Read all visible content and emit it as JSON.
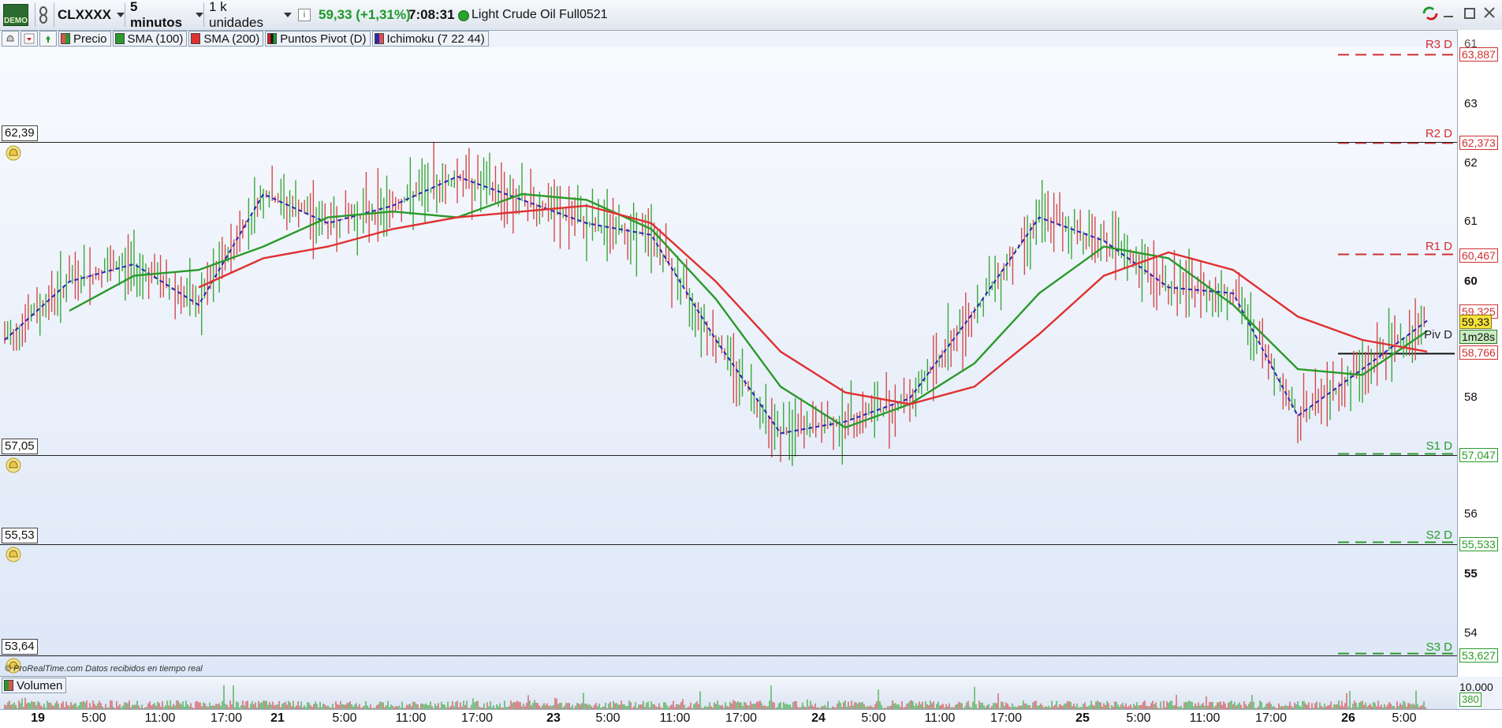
{
  "toolbar": {
    "demo_label": "DEMO",
    "ticker": "CLXXXX",
    "timeframe": "5 minutos",
    "units": "1 k unidades",
    "info_icon": "i",
    "price_change": "59,33 (+1,31%)",
    "time": "7:08:31",
    "instrument": "Light Crude Oil Full0521",
    "status_color": "#29a329"
  },
  "legend": {
    "items": [
      {
        "label": "Precio",
        "color": "#e05050"
      },
      {
        "label": "SMA (100)",
        "color": "#2a9a2a"
      },
      {
        "label": "SMA (200)",
        "color": "#e03030"
      },
      {
        "label": "Puntos Pivot (D)",
        "color": "#222222"
      },
      {
        "label": "Ichimoku (7 22 44)",
        "color": "#2a2aaa"
      }
    ]
  },
  "alert_lines": [
    {
      "label": "62,39"
    },
    {
      "label": "57,05"
    },
    {
      "label": "55,53"
    },
    {
      "label": "53,64"
    }
  ],
  "pivots": [
    {
      "label": "R3 D",
      "value": "63,887",
      "color": "#d03030"
    },
    {
      "label": "R2 D",
      "value": "62,373",
      "color": "#d03030"
    },
    {
      "label": "R1 D",
      "value": "60,467",
      "color": "#d03030"
    },
    {
      "label": "Piv D",
      "value": "58,766",
      "color": "#222222"
    },
    {
      "label": "S1 D",
      "value": "57,047",
      "color": "#2a9a2a"
    },
    {
      "label": "S2 D",
      "value": "55,533",
      "color": "#2a9a2a"
    },
    {
      "label": "S3 D",
      "value": "53,627",
      "color": "#2a9a2a"
    }
  ],
  "price_axis": {
    "ticks": [
      "61",
      "63",
      "62",
      "61",
      "60",
      "58",
      "56",
      "55",
      "54"
    ],
    "current_price": "59,33",
    "countdown": "1m28s",
    "upper_tag": "59,325",
    "lower_tag": "58,766",
    "volume_scale": "10.000",
    "volume_value": "380"
  },
  "volume": {
    "title": "Volumen"
  },
  "watermark": "© ProRealTime.com  Datos recibidos en tiempo real",
  "time_axis": {
    "labels": [
      "19",
      "5:00",
      "11:00",
      "17:00",
      "21",
      "5:00",
      "11:00",
      "17:00",
      "23",
      "5:00",
      "11:00",
      "17:00",
      "24",
      "5:00",
      "11:00",
      "17:00",
      "25",
      "5:00",
      "11:00",
      "17:00",
      "26",
      "5:00"
    ]
  },
  "chart_data": {
    "type": "line",
    "title": "",
    "xlabel": "",
    "ylabel": "",
    "ylim": [
      53.4,
      64.1
    ],
    "x": [
      "19 00:00",
      "19 05:00",
      "19 11:00",
      "19 17:00",
      "21 00:00",
      "21 05:00",
      "21 11:00",
      "21 17:00",
      "23 00:00",
      "23 05:00",
      "23 11:00",
      "23 17:00",
      "24 00:00",
      "24 05:00",
      "24 11:00",
      "24 17:00",
      "25 00:00",
      "25 05:00",
      "25 11:00",
      "25 17:00",
      "26 00:00",
      "26 05:00",
      "26 07:08"
    ],
    "series": [
      {
        "name": "Precio",
        "values": [
          59.0,
          60.0,
          60.3,
          59.6,
          61.5,
          61.0,
          61.3,
          61.8,
          61.4,
          61.0,
          60.8,
          59.0,
          57.4,
          57.6,
          58.0,
          59.5,
          61.1,
          60.7,
          59.9,
          59.8,
          57.7,
          58.5,
          59.33
        ]
      },
      {
        "name": "SMA (100)",
        "values": [
          null,
          59.5,
          60.1,
          60.2,
          60.6,
          61.1,
          61.2,
          61.1,
          61.5,
          61.4,
          60.9,
          59.7,
          58.2,
          57.5,
          57.9,
          58.6,
          59.8,
          60.6,
          60.4,
          59.6,
          58.5,
          58.4,
          59.15
        ]
      },
      {
        "name": "SMA (200)",
        "values": [
          null,
          null,
          null,
          59.9,
          60.4,
          60.6,
          60.9,
          61.1,
          61.2,
          61.3,
          61.0,
          60.0,
          58.8,
          58.1,
          57.9,
          58.2,
          59.1,
          60.1,
          60.5,
          60.2,
          59.4,
          59.0,
          58.8
        ]
      }
    ],
    "pivot_levels": {
      "R3": 63.887,
      "R2": 62.373,
      "R1": 60.467,
      "Piv": 58.766,
      "S1": 57.047,
      "S2": 55.533,
      "S3": 53.627
    },
    "grid": false,
    "legend_position": "top-left"
  }
}
